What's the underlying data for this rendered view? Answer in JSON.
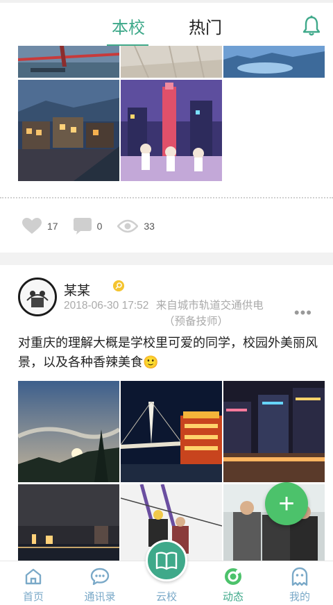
{
  "header": {
    "tabs": [
      {
        "label": "本校",
        "active": true
      },
      {
        "label": "热门",
        "active": false
      }
    ],
    "accent_color": "#3fa98a"
  },
  "post1": {
    "likes": "17",
    "comments": "0",
    "views": "33"
  },
  "post2": {
    "author": "某某",
    "datetime": "2018-06-30 17:52",
    "source": "来自城市轨道交通供电",
    "source_note": "（预备技师）",
    "text": "对重庆的理解大概是学校里可爱的同学，校园外美丽风景，以及各种香辣美食🙂",
    "more": "•••"
  },
  "fab": {
    "label": "+"
  },
  "bottom_nav": {
    "items": [
      {
        "label": "首页",
        "icon": "home-icon"
      },
      {
        "label": "通讯录",
        "icon": "chat-icon"
      },
      {
        "label": "云校",
        "icon": "book-icon"
      },
      {
        "label": "动态",
        "icon": "moments-icon",
        "active": true
      },
      {
        "label": "我的",
        "icon": "ghost-icon"
      }
    ]
  }
}
